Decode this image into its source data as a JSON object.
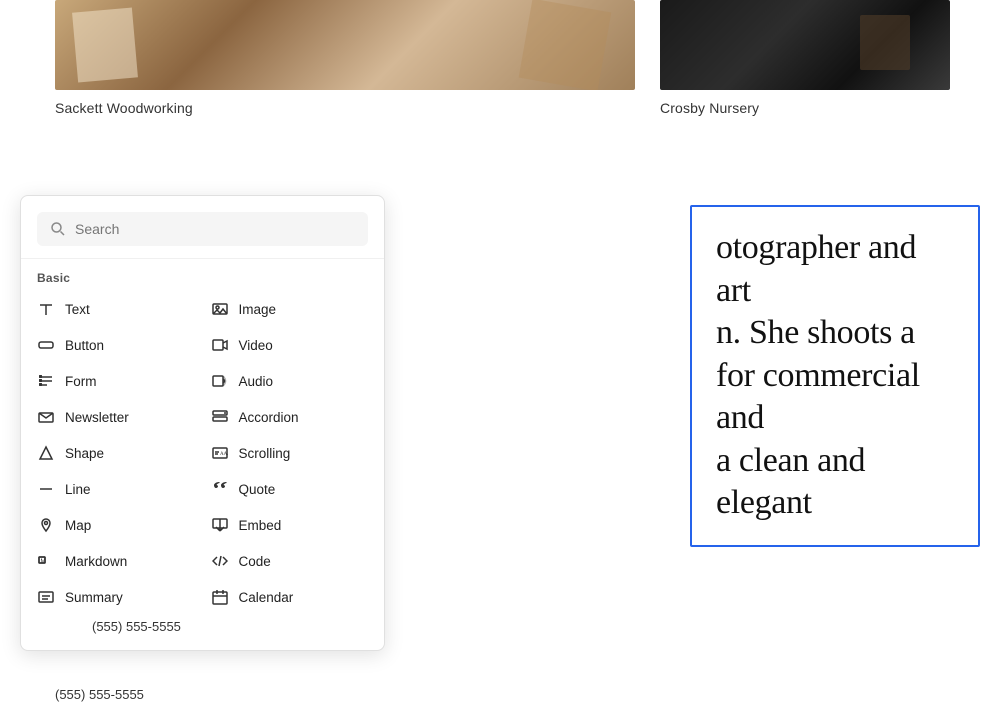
{
  "top": {
    "project1_title": "Sackett Woodworking",
    "project2_title": "Crosby Nursery"
  },
  "panel": {
    "search_placeholder": "Search",
    "section_basic": "Basic",
    "phone": "(555) 555-5555",
    "items_left": [
      {
        "id": "text",
        "label": "Text",
        "icon": "text"
      },
      {
        "id": "button",
        "label": "Button",
        "icon": "button"
      },
      {
        "id": "form",
        "label": "Form",
        "icon": "form"
      },
      {
        "id": "newsletter",
        "label": "Newsletter",
        "icon": "newsletter"
      },
      {
        "id": "shape",
        "label": "Shape",
        "icon": "shape"
      },
      {
        "id": "line",
        "label": "Line",
        "icon": "line"
      },
      {
        "id": "map",
        "label": "Map",
        "icon": "map"
      },
      {
        "id": "markdown",
        "label": "Markdown",
        "icon": "markdown"
      },
      {
        "id": "summary",
        "label": "Summary",
        "icon": "summary"
      }
    ],
    "items_right": [
      {
        "id": "image",
        "label": "Image",
        "icon": "image"
      },
      {
        "id": "video",
        "label": "Video",
        "icon": "video"
      },
      {
        "id": "audio",
        "label": "Audio",
        "icon": "audio"
      },
      {
        "id": "accordion",
        "label": "Accordion",
        "icon": "accordion"
      },
      {
        "id": "scrolling",
        "label": "Scrolling",
        "icon": "scrolling"
      },
      {
        "id": "quote",
        "label": "Quote",
        "icon": "quote"
      },
      {
        "id": "embed",
        "label": "Embed",
        "icon": "embed"
      },
      {
        "id": "code",
        "label": "Code",
        "icon": "code"
      },
      {
        "id": "calendar",
        "label": "Calendar",
        "icon": "calendar"
      }
    ]
  },
  "text_area": {
    "content": "otographer and art n. She shoots a for commercial and a clean and elegant"
  }
}
